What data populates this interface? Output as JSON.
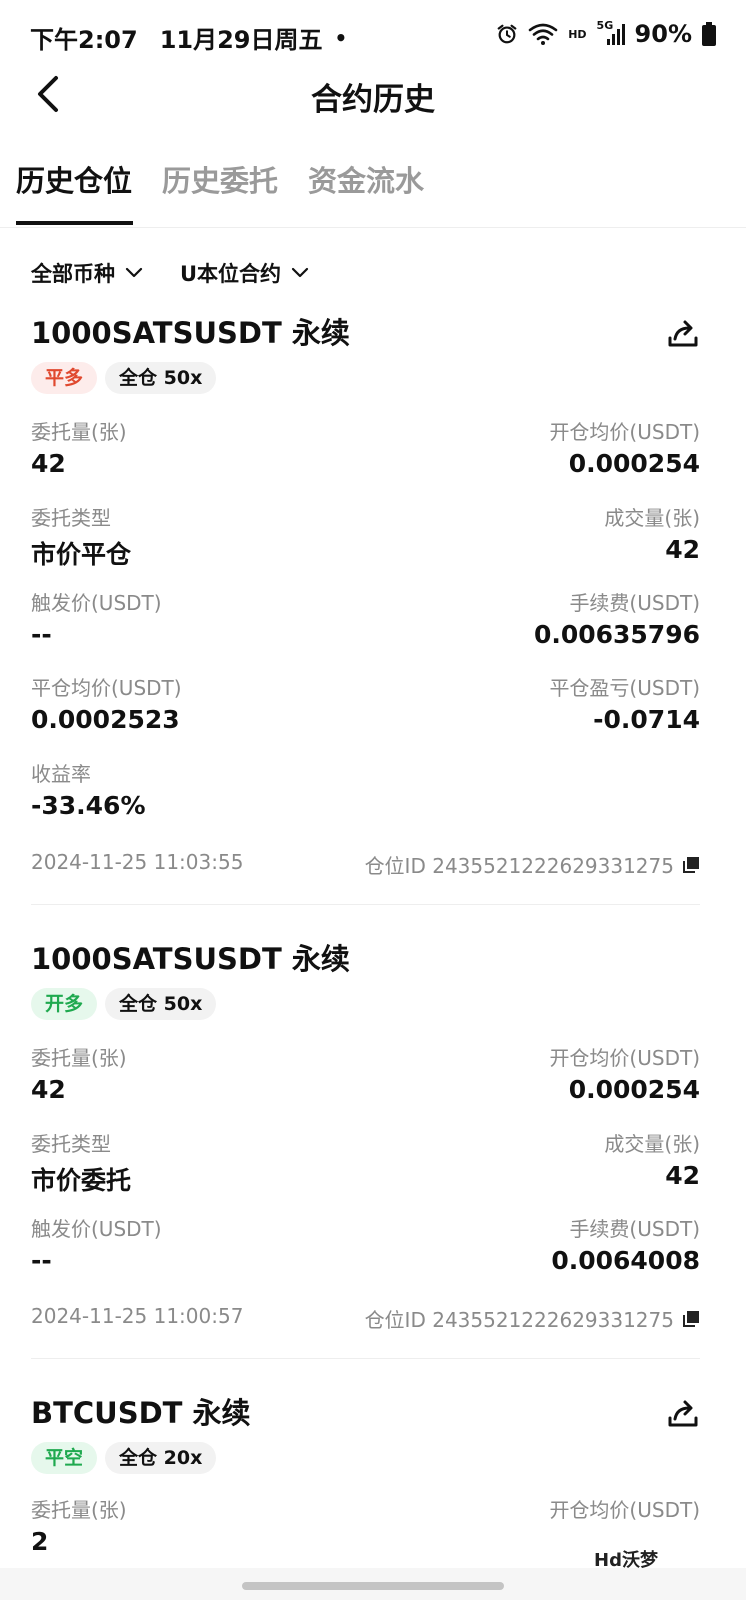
{
  "status_bar": {
    "time": "下午2:07",
    "date": "11月29日周五",
    "dot": "•",
    "hd": "HD",
    "network": "5G",
    "battery": "90%"
  },
  "nav": {
    "title": "合约历史"
  },
  "tabs": [
    {
      "label": "历史仓位",
      "active": true
    },
    {
      "label": "历史委托",
      "active": false
    },
    {
      "label": "资金流水",
      "active": false
    }
  ],
  "filters": {
    "coin": "全部币种",
    "contract": "U本位合约"
  },
  "cards": [
    {
      "title": "1000SATSUSDT 永续",
      "tag_side": "平多",
      "tag_margin": "全仓 50x",
      "fields": [
        {
          "label": "委托量(张)",
          "value": "42"
        },
        {
          "label": "开仓均价(USDT)",
          "value": "0.000254"
        },
        {
          "label": "委托类型",
          "value": "市价平仓"
        },
        {
          "label": "成交量(张)",
          "value": "42"
        },
        {
          "label": "触发价(USDT)",
          "value": "--"
        },
        {
          "label": "手续费(USDT)",
          "value": "0.00635796"
        },
        {
          "label": "平仓均价(USDT)",
          "value": "0.0002523"
        },
        {
          "label": "平仓盈亏(USDT)",
          "value": "-0.0714"
        },
        {
          "label": "收益率",
          "value": "-33.46%"
        }
      ],
      "timestamp": "2024-11-25 11:03:55",
      "position_id": "仓位ID 2435521222629331275"
    },
    {
      "title": "1000SATSUSDT 永续",
      "tag_side": "开多",
      "tag_margin": "全仓 50x",
      "fields": [
        {
          "label": "委托量(张)",
          "value": "42"
        },
        {
          "label": "开仓均价(USDT)",
          "value": "0.000254"
        },
        {
          "label": "委托类型",
          "value": "市价委托"
        },
        {
          "label": "成交量(张)",
          "value": "42"
        },
        {
          "label": "触发价(USDT)",
          "value": "--"
        },
        {
          "label": "手续费(USDT)",
          "value": "0.0064008"
        }
      ],
      "timestamp": "2024-11-25 11:00:57",
      "position_id": "仓位ID 2435521222629331275"
    },
    {
      "title": "BTCUSDT 永续",
      "tag_side": "平空",
      "tag_margin": "全仓 20x",
      "fields": [
        {
          "label": "委托量(张)",
          "value": "2"
        },
        {
          "label": "开仓均价(USDT)",
          "value": ""
        }
      ]
    }
  ],
  "watermark": "Hd沃梦",
  "colors": {
    "tag_red_text": "#e0492f",
    "tag_red_bg": "#fdeceb",
    "tag_green_text": "#1fa94f",
    "tag_green_bg": "#e6f8ec",
    "muted_text": "#8a8a8a"
  }
}
